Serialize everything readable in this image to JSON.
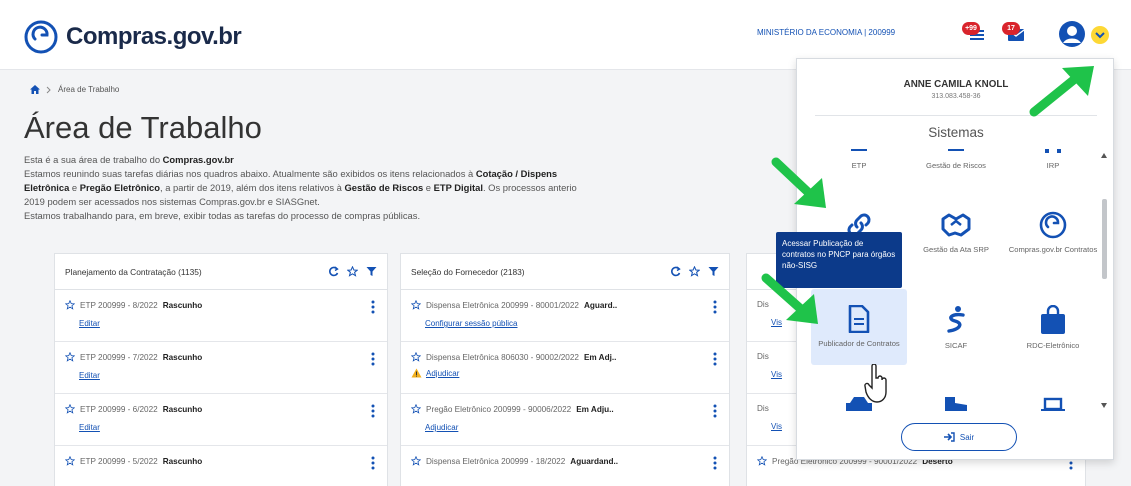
{
  "header": {
    "logo_text": "Compras.gov.br",
    "ministry": "MINISTÉRIO DA ECONOMIA | 200999",
    "notif_messages_badge": "+99",
    "notif_mail_badge": "17"
  },
  "breadcrumb": {
    "current": "Área de Trabalho"
  },
  "page": {
    "title": "Área de Trabalho",
    "intro_line1_pre": "Esta é a sua área de trabalho do ",
    "intro_line1_bold": "Compras.gov.br",
    "intro_line2_pre": "Estamos reunindo suas tarefas diárias nos quadros abaixo. Atualmente são exibidos os itens relacionados à ",
    "intro_line2_bold": "Cotação / Dispens",
    "intro_line3_b1": "Eletrônica",
    "intro_line3_t1": " e ",
    "intro_line3_b2": "Pregão Eletrônico",
    "intro_line3_t2": ", a partir de 2019, além dos itens relativos à ",
    "intro_line3_b3": "Gestão de Riscos",
    "intro_line3_t3": " e ",
    "intro_line3_b4": "ETP Digital",
    "intro_line3_t4": ". Os processos anterio",
    "intro_line4": "2019 podem ser acessados nos sistemas Compras.gov.br e SIASGnet.",
    "intro_line5": "Estamos trabalhando para, em breve, exibir todas as tarefas do processo de compras públicas."
  },
  "cards": {
    "planning": {
      "title": "Planejamento da Contratação (1135)",
      "items": [
        {
          "text": "ETP 200999 - 8/2022",
          "status": "Rascunho",
          "link": "Editar"
        },
        {
          "text": "ETP 200999 - 7/2022",
          "status": "Rascunho",
          "link": "Editar"
        },
        {
          "text": "ETP 200999 - 6/2022",
          "status": "Rascunho",
          "link": "Editar"
        },
        {
          "text": "ETP 200999 - 5/2022",
          "status": "Rascunho",
          "link": ""
        }
      ]
    },
    "supplier": {
      "title": "Seleção do Fornecedor (2183)",
      "items": [
        {
          "text": "Dispensa Eletrônica 200999 - 80001/2022",
          "status": "Aguard..",
          "link": "Configurar sessão pública"
        },
        {
          "text": "Dispensa Eletrônica 806030 - 90002/2022",
          "status": "Em Adj..",
          "link": "Adjudicar"
        },
        {
          "text": "Pregão Eletrônico 200999 - 90006/2022",
          "status": "Em Adju..",
          "link": "Adjudicar"
        },
        {
          "text": "Dispensa Eletrônica 200999 - 18/2022",
          "status": "Aguardand..",
          "link": ""
        }
      ]
    },
    "third": {
      "partial_rows": [
        "Dis",
        "Dis",
        "Dis"
      ],
      "partial_links": [
        "Vis",
        "Vis",
        "Vis"
      ],
      "bottom_text": "Pregão Eletrônico 200999 - 90001/2022",
      "bottom_status": "Deserto"
    }
  },
  "panel": {
    "user_name": "ANNE CAMILA KNOLL",
    "user_cpf": "313.083.458-36",
    "systems_title": "Sistemas",
    "tiles": {
      "etp": "ETP",
      "gestao_riscos": "Gestão de Riscos",
      "irp": "IRP",
      "gestao_ata": "Gestão da Ata SRP",
      "compras_contratos": "Compras.gov.br Contratos",
      "publicador": "Publicador de Contratos",
      "sicaf": "SICAF",
      "rdc": "RDC-Eletrônico"
    },
    "tooltip": "Acessar Publicação de contratos no PNCP para órgãos não-SISG",
    "logout": "Sair"
  },
  "colors": {
    "brand_blue": "#1351b4",
    "dark_blue": "#0c3a8a",
    "badge_red": "#d9242c",
    "arrow_green": "#1fc34a",
    "caret_yellow": "#fdd835"
  }
}
